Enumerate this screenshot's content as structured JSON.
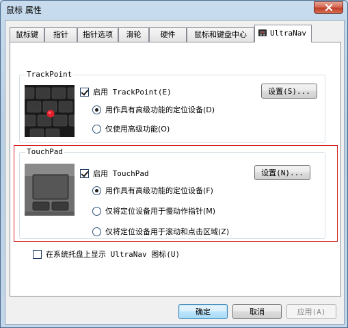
{
  "window": {
    "title": "鼠标 属性"
  },
  "tabs": [
    {
      "label": "鼠标键"
    },
    {
      "label": "指针"
    },
    {
      "label": "指针选项"
    },
    {
      "label": "滑轮"
    },
    {
      "label": "硬件"
    },
    {
      "label": "鼠标和键盘中心"
    },
    {
      "label": "UltraNav"
    }
  ],
  "trackpoint": {
    "group_label": "TrackPoint",
    "enable_label": "启用 TrackPoint(E)",
    "enable_checked": true,
    "settings_button": "设置(S)...",
    "options": [
      {
        "label": "用作具有高级功能的定位设备(D)",
        "selected": true
      },
      {
        "label": "仅使用高级功能(O)",
        "selected": false
      }
    ]
  },
  "touchpad": {
    "group_label": "TouchPad",
    "enable_label": "启用 TouchPad",
    "enable_checked": true,
    "settings_button": "设置(N)...",
    "options": [
      {
        "label": "用作具有高级功能的定位设备(F)",
        "selected": true
      },
      {
        "label": "仅将定位设备用于慢动作指针(M)",
        "selected": false
      },
      {
        "label": "仅将定位设备用于滚动和点击区域(Z)",
        "selected": false
      }
    ]
  },
  "tray_option": {
    "label": "在系统托盘上显示 UltraNav 图标(U)",
    "checked": false
  },
  "buttons": {
    "ok": "确定",
    "cancel": "取消",
    "apply": "应用(A)"
  },
  "colors": {
    "highlight_outline": "#d21f1f",
    "trackpoint_nub": "#e0202a"
  }
}
